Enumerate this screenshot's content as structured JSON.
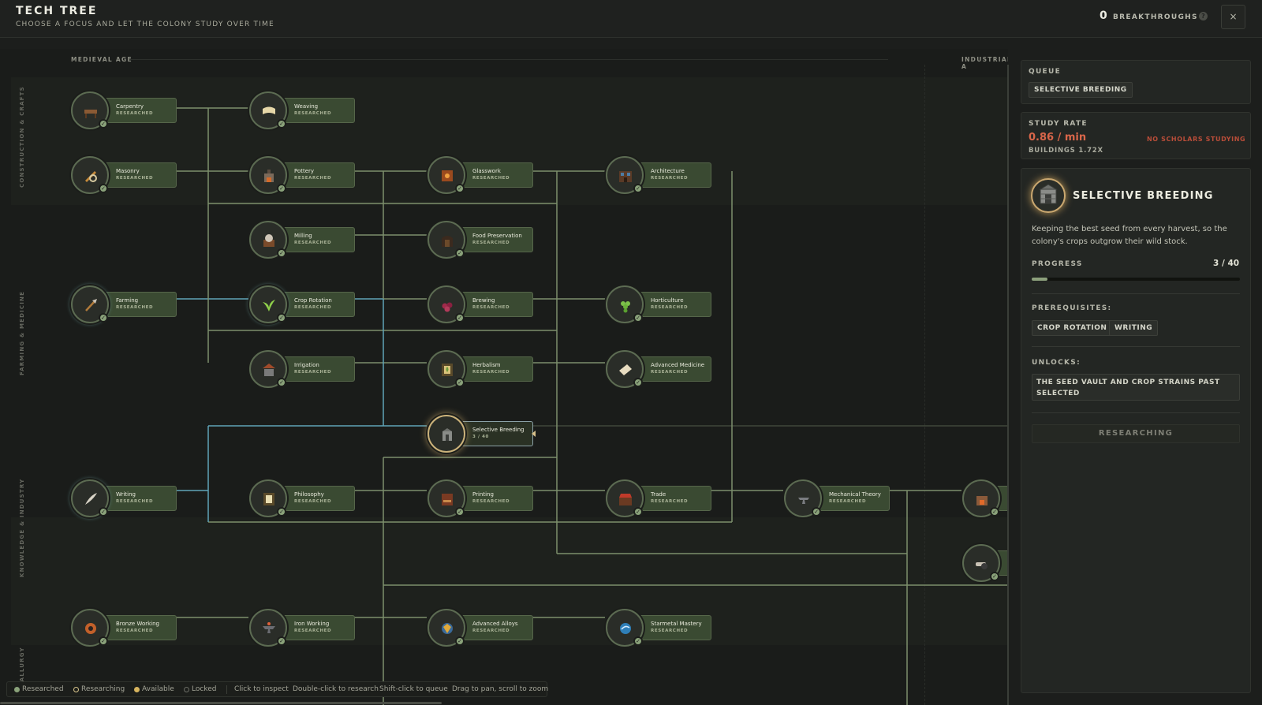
{
  "header": {
    "title": "TECH TREE",
    "subtitle": "CHOOSE A FOCUS AND LET THE COLONY STUDY OVER TIME",
    "breakthroughs_count": "0",
    "breakthroughs_label": "BREAKTHROUGHS",
    "help": "?",
    "close": "×"
  },
  "eras": [
    "MEDIEVAL AGE",
    "INDUSTRIAL A"
  ],
  "lanes": [
    "CONSTRUCTION & CRAFTS",
    "FARMING & MEDICINE",
    "KNOWLEDGE & INDUSTRY",
    "METALLURGY"
  ],
  "nodes": [
    {
      "name": "Carpentry",
      "status": "RESEARCHED",
      "icon": "workbench-icon"
    },
    {
      "name": "Weaving",
      "status": "RESEARCHED",
      "icon": "cloth-roll-icon"
    },
    {
      "name": "Masonry",
      "status": "RESEARCHED",
      "icon": "stone-tools-icon"
    },
    {
      "name": "Pottery",
      "status": "RESEARCHED",
      "icon": "kiln-icon"
    },
    {
      "name": "Glasswork",
      "status": "RESEARCHED",
      "icon": "furnace-icon"
    },
    {
      "name": "Architecture",
      "status": "RESEARCHED",
      "icon": "building-icon"
    },
    {
      "name": "Milling",
      "status": "RESEARCHED",
      "icon": "millstone-icon"
    },
    {
      "name": "Food Preservation",
      "status": "RESEARCHED",
      "icon": "cellar-icon"
    },
    {
      "name": "Farming",
      "status": "RESEARCHED",
      "icon": "hoe-icon"
    },
    {
      "name": "Crop Rotation",
      "status": "RESEARCHED",
      "icon": "sprout-icon"
    },
    {
      "name": "Brewing",
      "status": "RESEARCHED",
      "icon": "berries-icon"
    },
    {
      "name": "Horticulture",
      "status": "RESEARCHED",
      "icon": "grapes-icon"
    },
    {
      "name": "Irrigation",
      "status": "RESEARCHED",
      "icon": "well-icon"
    },
    {
      "name": "Herbalism",
      "status": "RESEARCHED",
      "icon": "herb-shrine-icon"
    },
    {
      "name": "Advanced Medicine",
      "status": "RESEARCHED",
      "icon": "bandage-icon"
    },
    {
      "name": "Selective Breeding",
      "status": "3 / 40",
      "icon": "seed-vault-icon"
    },
    {
      "name": "Writing",
      "status": "RESEARCHED",
      "icon": "quill-icon"
    },
    {
      "name": "Philosophy",
      "status": "RESEARCHED",
      "icon": "scroll-shrine-icon"
    },
    {
      "name": "Printing",
      "status": "RESEARCHED",
      "icon": "press-icon"
    },
    {
      "name": "Trade",
      "status": "RESEARCHED",
      "icon": "market-stall-icon"
    },
    {
      "name": "Mechanical Theory",
      "status": "RESEARCHED",
      "icon": "anvil-icon"
    },
    {
      "name": "",
      "status": "",
      "icon": "forge-icon"
    },
    {
      "name": "",
      "status": "",
      "icon": "cannon-icon"
    },
    {
      "name": "Bronze Working",
      "status": "RESEARCHED",
      "icon": "bronze-ore-icon"
    },
    {
      "name": "Iron Working",
      "status": "RESEARCHED",
      "icon": "iron-anvil-icon"
    },
    {
      "name": "Advanced Alloys",
      "status": "RESEARCHED",
      "icon": "alloy-orb-icon"
    },
    {
      "name": "Starmetal Mastery",
      "status": "RESEARCHED",
      "icon": "starmetal-icon"
    }
  ],
  "legend": {
    "researched": "Researched",
    "researching": "Researching",
    "available": "Available",
    "locked": "Locked",
    "hint_click": "Click to inspect",
    "hint_double": "Double-click to research",
    "hint_shift": "Shift-click to queue",
    "hint_drag": "Drag to pan, scroll to zoom"
  },
  "panel": {
    "queue_label": "QUEUE",
    "queue_items": [
      "SELECTIVE BREEDING"
    ],
    "study_rate_label": "STUDY RATE",
    "study_rate": "0.86 / min",
    "buildings": "BUILDINGS 1.72X",
    "no_scholars": "NO SCHOLARS STUDYING",
    "selected_title": "SELECTIVE BREEDING",
    "description": "Keeping the best seed from every harvest, so the colony's crops outgrow their wild stock.",
    "progress_label": "PROGRESS",
    "progress_text": "3 / 40",
    "progress_fraction": 0.075,
    "prereq_label": "PREREQUISITES:",
    "prerequisites": [
      "CROP ROTATION",
      "WRITING"
    ],
    "unlocks_label": "UNLOCKS:",
    "unlocks": "THE SEED VAULT AND CROP STRAINS PAST SELECTED",
    "action_button": "RESEARCHING"
  },
  "colors": {
    "card": "#3a4a32",
    "line": "#8a9c76",
    "active_path": "#5fa3b8",
    "warning": "#d9664a",
    "check": "#8aa27a"
  }
}
